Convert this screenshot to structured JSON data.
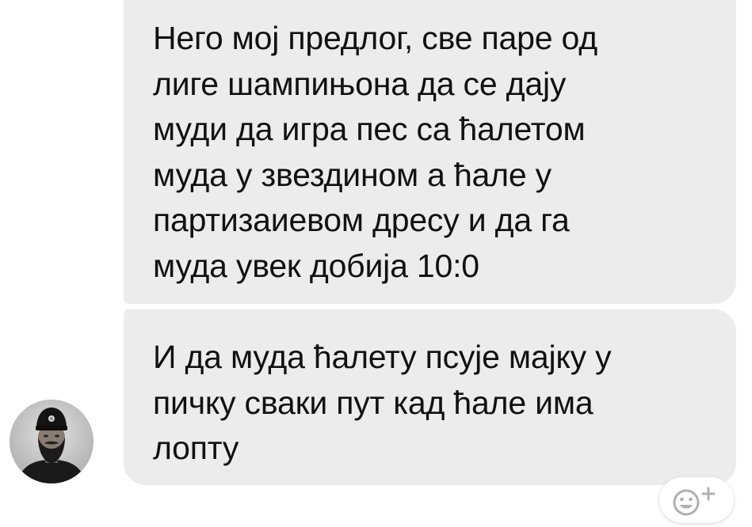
{
  "messages": [
    {
      "lines": [
        "Него мој предлог, све паре од",
        "лиге шампињона да се дају",
        "муди да игра пес са ћалетом",
        "муда у звездином а ћале у",
        "партизаиевом дресу и да га",
        "муда увек добија 10:0"
      ]
    },
    {
      "lines": [
        "И да муда ћалету псује мајку у",
        "пичку сваки пут кад ћале има",
        "лопту"
      ]
    }
  ],
  "reaction_button": {
    "icon": "add-reaction-icon"
  },
  "avatar": {
    "icon": "profile-photo"
  },
  "colors": {
    "bubble_bg": "#ececec",
    "text": "#111111",
    "icon": "#b0b0b0"
  }
}
